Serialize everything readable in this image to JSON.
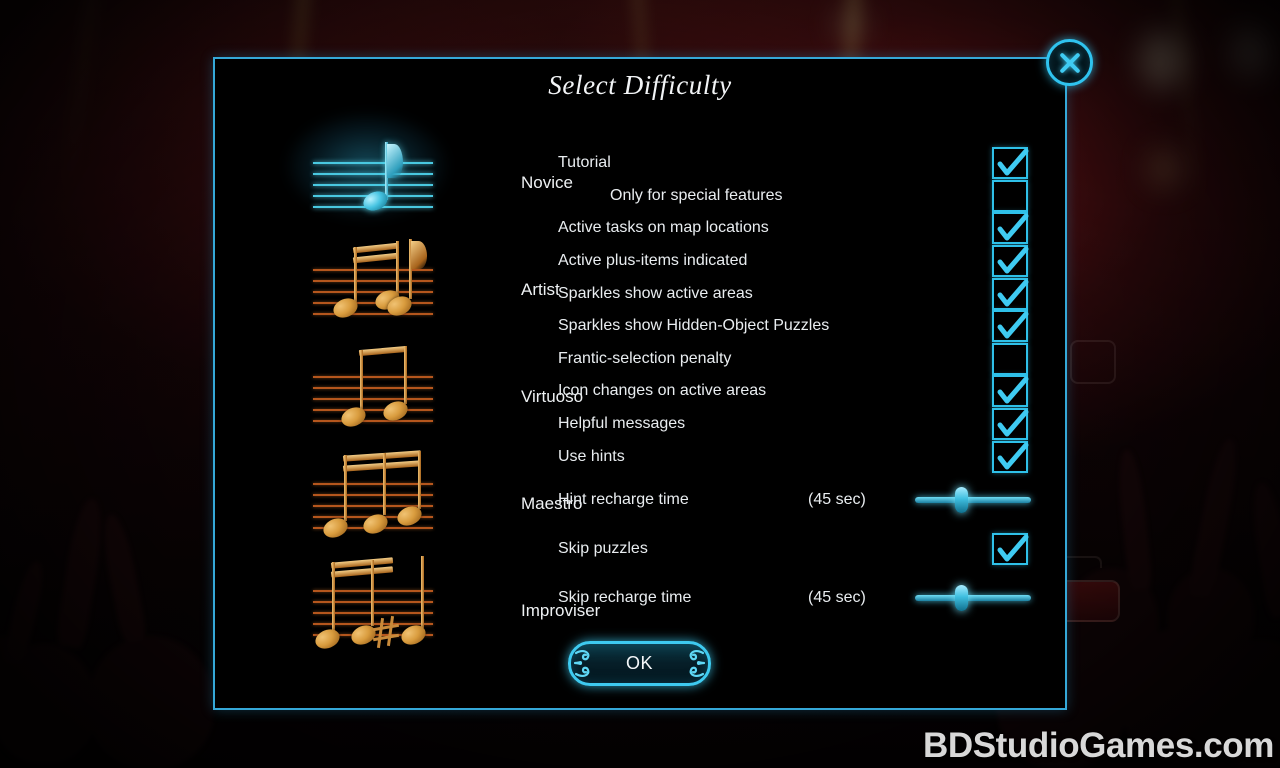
{
  "dialog": {
    "title": "Select Difficulty",
    "close_icon": "close-x-icon",
    "border_color": "#35a8d8"
  },
  "difficulty": {
    "selected": "Novice",
    "selected_color": "#49c8e0",
    "unselected_color": "#b5561d",
    "levels": [
      {
        "label": "Novice",
        "selected": true
      },
      {
        "label": "Artist",
        "selected": false
      },
      {
        "label": "Virtuoso",
        "selected": false
      },
      {
        "label": "Maestro",
        "selected": false
      },
      {
        "label": "Improviser",
        "selected": false
      }
    ]
  },
  "options": {
    "checkboxes": [
      {
        "label": "Tutorial",
        "checked": true,
        "indent": false
      },
      {
        "label": "Only for special features",
        "checked": false,
        "indent": true
      },
      {
        "label": "Active tasks on map locations",
        "checked": true,
        "indent": false
      },
      {
        "label": "Active plus-items indicated",
        "checked": true,
        "indent": false
      },
      {
        "label": "Sparkles show active areas",
        "checked": true,
        "indent": false
      },
      {
        "label": "Sparkles show Hidden-Object Puzzles",
        "checked": true,
        "indent": false
      },
      {
        "label": "Frantic-selection penalty",
        "checked": false,
        "indent": false
      },
      {
        "label": "Icon changes on active areas",
        "checked": true,
        "indent": false
      },
      {
        "label": "Helpful messages",
        "checked": true,
        "indent": false
      },
      {
        "label": "Use hints",
        "checked": true,
        "indent": false
      }
    ],
    "hint_recharge": {
      "label": "Hint recharge time",
      "value_text": "(45 sec)",
      "percent": 40
    },
    "skip_puzzles": {
      "label": "Skip puzzles",
      "checked": true
    },
    "skip_recharge": {
      "label": "Skip recharge time",
      "value_text": "(45 sec)",
      "percent": 40
    }
  },
  "ok_button": {
    "label": "OK"
  },
  "watermark": {
    "text": "BDStudioGames.com"
  }
}
